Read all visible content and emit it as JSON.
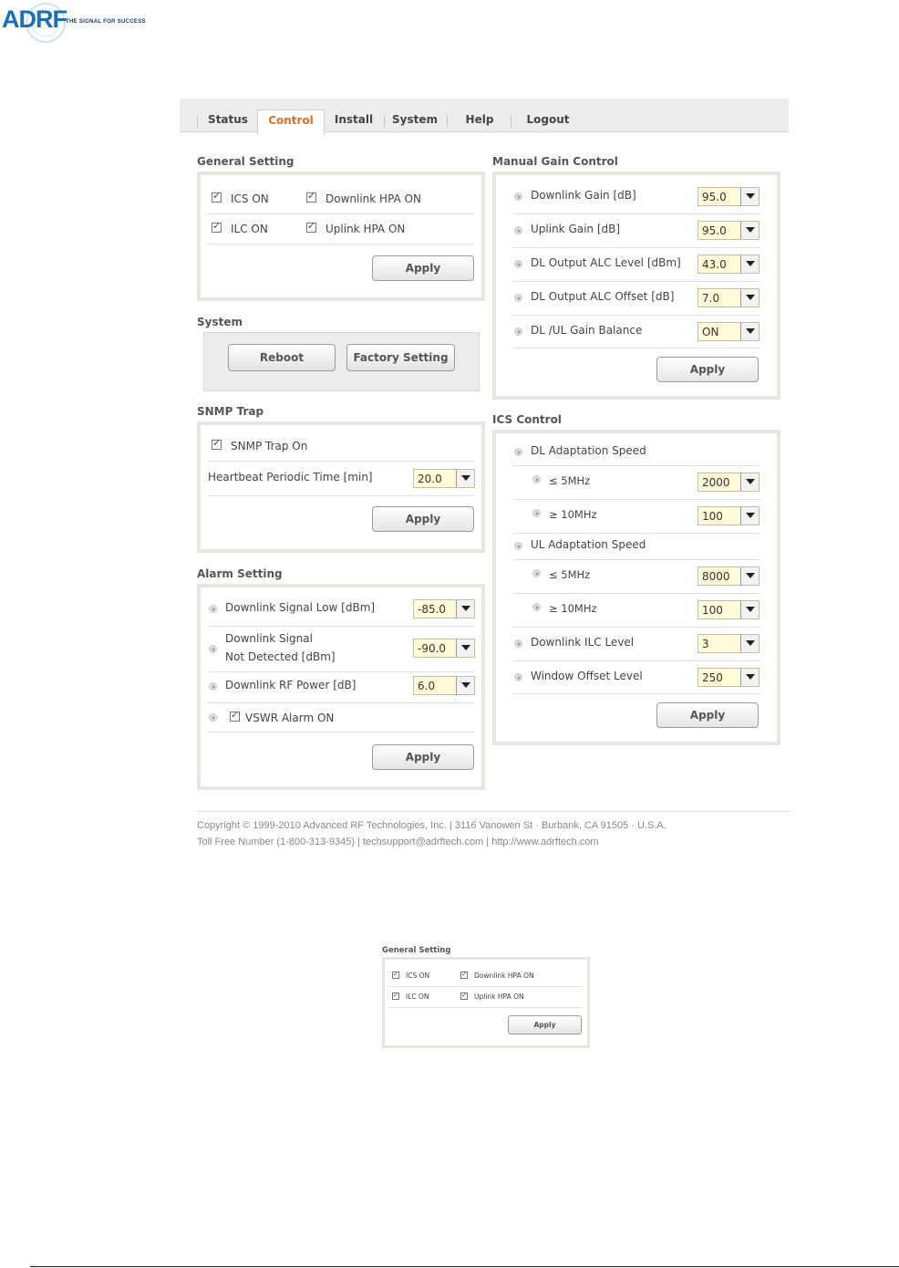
{
  "logo": {
    "text": "ADRF",
    "tagline": "THE SIGNAL FOR SUCCESS"
  },
  "tabs": [
    "Status",
    "Control",
    "Install",
    "System",
    "Help",
    "Logout"
  ],
  "active_tab": "Control",
  "general_setting": {
    "title": "General Setting",
    "ics_on": "ICS ON",
    "downlink_hpa_on": "Downlink HPA ON",
    "ilc_on": "ILC ON",
    "uplink_hpa_on": "Uplink HPA ON",
    "apply": "Apply"
  },
  "system": {
    "title": "System",
    "reboot": "Reboot",
    "factory_setting": "Factory Setting"
  },
  "snmp_trap": {
    "title": "SNMP Trap",
    "trap_on": "SNMP Trap On",
    "heartbeat_label": "Heartbeat Periodic Time [min]",
    "heartbeat_value": "20.0",
    "apply": "Apply"
  },
  "alarm_setting": {
    "title": "Alarm Setting",
    "dl_signal_low_label": "Downlink Signal Low [dBm]",
    "dl_signal_low_value": "-85.0",
    "dl_signal_nd_label_1": "Downlink Signal",
    "dl_signal_nd_label_2": "Not Detected [dBm]",
    "dl_signal_nd_value": "-90.0",
    "dl_rf_power_label": "Downlink RF Power [dB]",
    "dl_rf_power_value": "6.0",
    "vswr_alarm_on": "VSWR Alarm ON",
    "apply": "Apply"
  },
  "manual_gain": {
    "title": "Manual Gain Control",
    "dl_gain_label": "Downlink Gain [dB]",
    "dl_gain_value": "95.0",
    "ul_gain_label": "Uplink Gain [dB]",
    "ul_gain_value": "95.0",
    "alc_level_label": "DL Output ALC Level [dBm]",
    "alc_level_value": "43.0",
    "alc_offset_label": "DL Output ALC Offset [dB]",
    "alc_offset_value": "7.0",
    "balance_label": "DL /UL Gain Balance",
    "balance_value": "ON",
    "apply": "Apply"
  },
  "ics_control": {
    "title": "ICS Control",
    "dl_speed_label": "DL Adaptation Speed",
    "dl_5_label": "≤ 5MHz",
    "dl_5_value": "2000",
    "dl_10_label": "≥ 10MHz",
    "dl_10_value": "100",
    "ul_speed_label": "UL Adaptation Speed",
    "ul_5_label": "≤ 5MHz",
    "ul_5_value": "8000",
    "ul_10_label": "≥ 10MHz",
    "ul_10_value": "100",
    "ilc_level_label": "Downlink ILC Level",
    "ilc_level_value": "3",
    "window_offset_label": "Window Offset Level",
    "window_offset_value": "250",
    "apply": "Apply"
  },
  "footer": {
    "line1": "Copyright © 1999-2010 Advanced RF Technologies, Inc. | 3116 Vanowen St · Burbank, CA 91505 · U.S.A.",
    "line2": "Toll Free Number (1-800-313-9345) | techsupport@adrftech.com | http://www.adrftech.com"
  },
  "mini": {
    "title": "General Setting",
    "ics_on": "ICS ON",
    "downlink_hpa_on": "Downlink HPA ON",
    "ilc_on": "ILC ON",
    "uplink_hpa_on": "Uplink HPA ON",
    "apply": "Apply"
  }
}
